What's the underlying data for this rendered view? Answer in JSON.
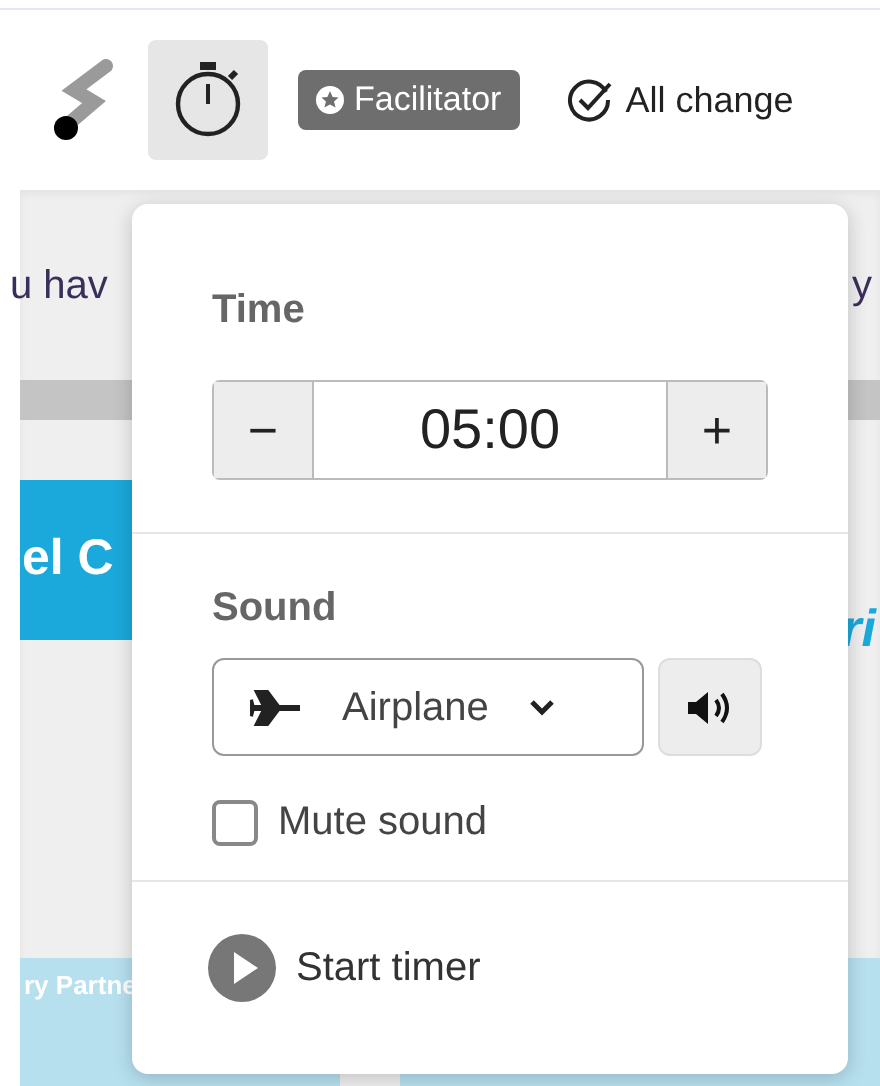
{
  "toolbar": {
    "badge": "Facilitator",
    "status": "All change"
  },
  "background": {
    "banner_left": "u hav",
    "banner_right": "y",
    "card_title": "el C",
    "side_text": "ri",
    "card_footer": "ry Partne"
  },
  "timer_popover": {
    "time_label": "Time",
    "minus": "−",
    "time_value": "05:00",
    "plus": "+",
    "sound_label": "Sound",
    "sound_select": "Airplane",
    "mute": {
      "label": "Mute sound",
      "checked": false
    },
    "start": "Start timer"
  }
}
